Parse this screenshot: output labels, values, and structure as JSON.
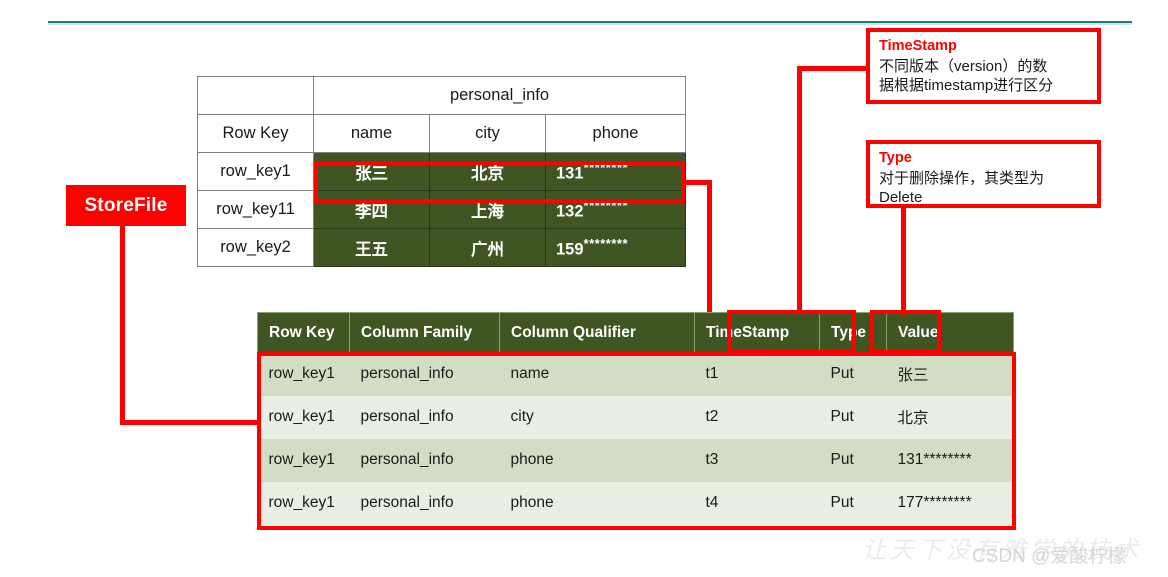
{
  "diagram": {
    "title_hidden": "",
    "accent_red": "#fe0000",
    "table_green": "#3f5522",
    "row_light": "#e9efe3",
    "row_dark": "#d3ddc6",
    "top_rule_color": "#1a8175"
  },
  "storefile_label": "StoreFile",
  "logical_table": {
    "family_header": "personal_info",
    "corner_blank": "",
    "columns": [
      "Row Key",
      "name",
      "city",
      "phone"
    ],
    "rows": [
      {
        "row_key": "row_key1",
        "name": "张三",
        "city": "北京",
        "phone_prefix": "131",
        "phone_mask": "********"
      },
      {
        "row_key": "row_key11",
        "name": "李四",
        "city": "上海",
        "phone_prefix": "132",
        "phone_mask": "********"
      },
      {
        "row_key": "row_key2",
        "name": "王五",
        "city": "广州",
        "phone_prefix": "159",
        "phone_mask": "********"
      }
    ]
  },
  "keyvalue_table": {
    "headers": [
      "Row Key",
      "Column Family",
      "Column Qualifier",
      "TimeStamp",
      "Type",
      "Value"
    ],
    "rows": [
      {
        "row_key": "row_key1",
        "column_family": "personal_info",
        "column_qualifier": "name",
        "timestamp": "t1",
        "type": "Put",
        "value": "张三"
      },
      {
        "row_key": "row_key1",
        "column_family": "personal_info",
        "column_qualifier": "city",
        "timestamp": "t2",
        "type": "Put",
        "value": "北京"
      },
      {
        "row_key": "row_key1",
        "column_family": "personal_info",
        "column_qualifier": "phone",
        "timestamp": "t3",
        "type": "Put",
        "value": "131********"
      },
      {
        "row_key": "row_key1",
        "column_family": "personal_info",
        "column_qualifier": "phone",
        "timestamp": "t4",
        "type": "Put",
        "value": "177********"
      }
    ]
  },
  "callouts": {
    "timestamp": {
      "title": "TimeStamp",
      "line1": "不同版本（version）的数",
      "line2": "据根据timestamp进行区分"
    },
    "type": {
      "title": "Type",
      "line1": "对于删除操作，其类型为",
      "line2": "Delete"
    }
  },
  "watermark": {
    "calligraphy": "让天下没有难学的技术",
    "csdn": "CSDN @爱酸柠檬"
  }
}
